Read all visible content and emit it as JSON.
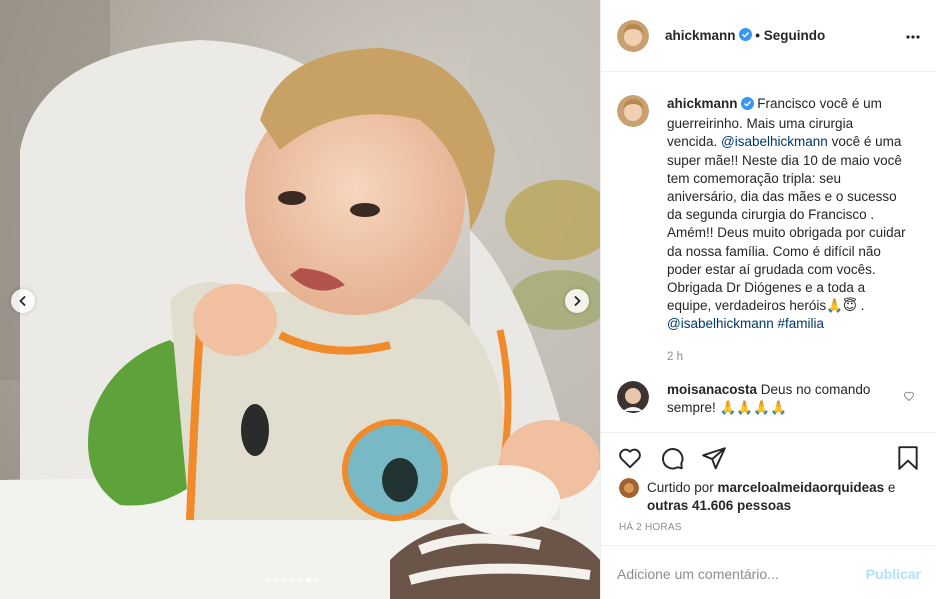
{
  "post": {
    "author": "ahickmann",
    "follow_status": "Seguindo",
    "more_icon": "more-options-icon",
    "verified_color": "#3897f0"
  },
  "media": {
    "carousel_total": 7,
    "carousel_active_index": 5
  },
  "caption": {
    "username": "ahickmann",
    "part1": "Francisco você é um guerreirinho. Mais uma cirurgia vencida. ",
    "mention1": "@isabelhickmann",
    "part2": " você é uma super mãe!! Neste dia 10 de maio você tem comemoração tripla: seu aniversário, dia das mães e o sucesso da segunda cirurgia do Francisco . Amém!! Deus muito obrigada por cuidar da nossa família. Como é difícil não poder estar aí grudada com vocês. Obrigada Dr Diógenes e a toda a equipe, verdadeiros heróis🙏😇 .",
    "mention2": "@isabelhickmann",
    "hashtag": "#familia",
    "time": "2 h"
  },
  "comment": {
    "username": "moisanacosta",
    "text": " Deus no comando sempre! 🙏🙏🙏🙏"
  },
  "likes": {
    "prefix": "Curtido por ",
    "user": "marceloalmeidaorquideas",
    "middle": " e ",
    "others": "outras 41.606 pessoas"
  },
  "timestamp": "HÁ 2 HORAS",
  "add_comment": {
    "placeholder": "Adicione um comentário...",
    "publish_label": "Publicar"
  },
  "colors": {
    "link": "#00376b",
    "muted": "#8e8e8e",
    "publish_disabled": "#b2dffc"
  }
}
